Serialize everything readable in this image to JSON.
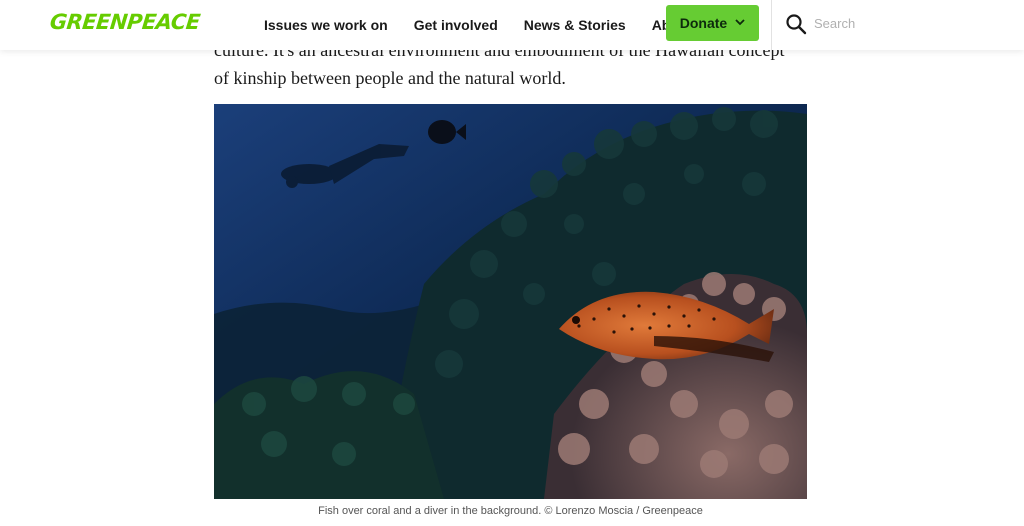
{
  "header": {
    "logo": "GREENPEACE",
    "nav": [
      "Issues we work on",
      "Get involved",
      "News & Stories",
      "About us"
    ],
    "donate_label": "Donate",
    "search_placeholder": "Search"
  },
  "article": {
    "paragraph_lines": [
      "culture. It's an ancestral environment and embodiment of the Hawaiian concept",
      "of kinship between people and the natural world."
    ],
    "caption": "Fish over coral and a diver in the background. © Lorenzo Moscia / Greenpeace"
  },
  "colors": {
    "brand_green": "#66cc00",
    "donate_bg": "#66cc33"
  },
  "icons": [
    "search-icon",
    "chevron-down-icon"
  ]
}
